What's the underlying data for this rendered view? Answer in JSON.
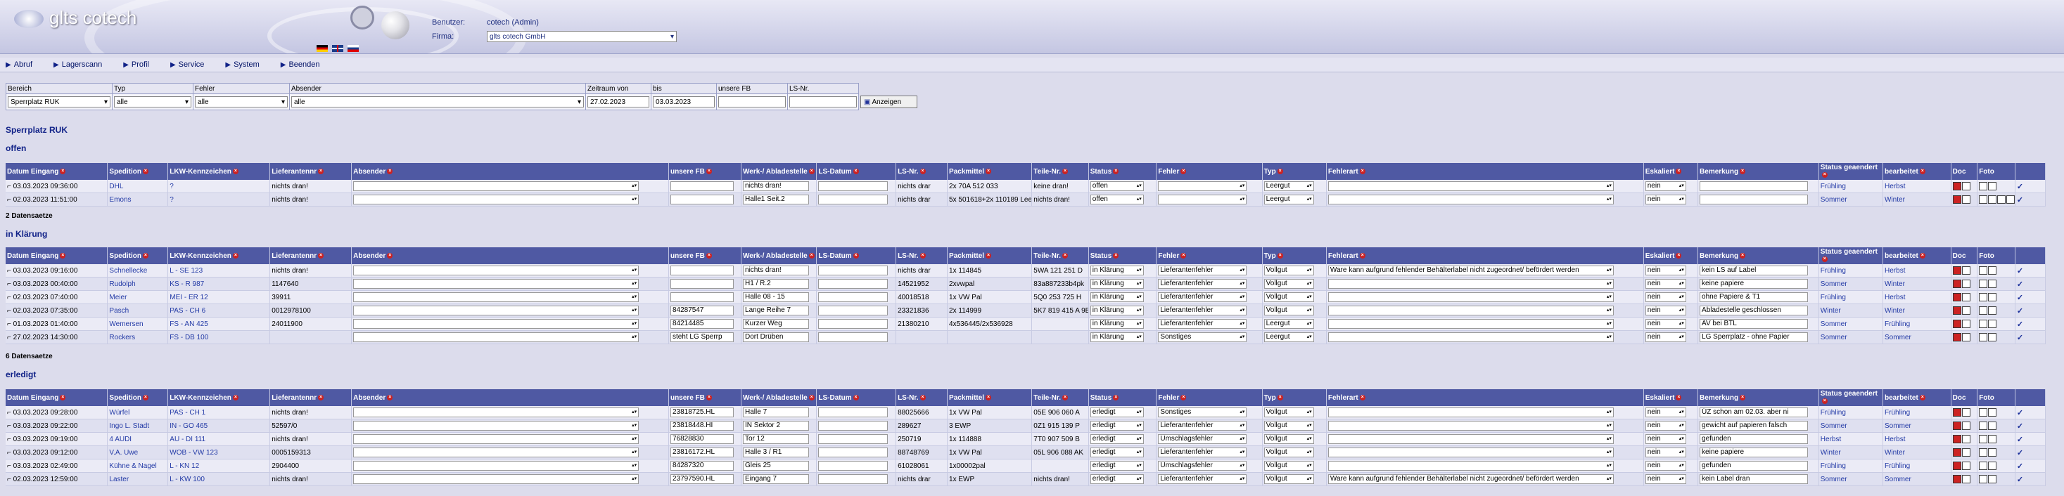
{
  "app": {
    "logo": "glts cotech"
  },
  "user": {
    "benutzer_label": "Benutzer:",
    "benutzer": "cotech (Admin)",
    "firma_label": "Firma:",
    "firma": "glts cotech GmbH"
  },
  "nav": [
    "Abruf",
    "Lagerscann",
    "Profil",
    "Service",
    "System",
    "Beenden"
  ],
  "filter": {
    "labels": [
      "Bereich",
      "Typ",
      "Fehler",
      "Absender",
      "Zeitraum von",
      "bis",
      "unsere FB",
      "LS-Nr."
    ],
    "bereich": "Sperrplatz RUK",
    "typ": "alle",
    "fehler": "alle",
    "absender": "alle",
    "von": "27.02.2023",
    "bis": "03.03.2023",
    "unsere_fb": "",
    "ls_nr": "",
    "button": "Anzeigen"
  },
  "page_title": "Sperrplatz RUK",
  "sections": [
    {
      "title": "offen",
      "count": "2 Datensaetze",
      "headers": [
        "Datum Eingang",
        "Spedition",
        "LKW-Kennzeichen",
        "Lieferantennr",
        "Absender",
        "unsere FB",
        "Werk-/ Abladestelle",
        "LS-Datum",
        "LS-Nr.",
        "Packmittel",
        "Teile-Nr.",
        "Status",
        "Fehler",
        "Typ",
        "Fehlerart",
        "Eskaliert",
        "Bemerkung",
        "Status geaendert",
        "bearbeitet",
        "Doc",
        "Foto",
        ""
      ],
      "rows": [
        [
          "03.03.2023 09:36:00",
          "DHL",
          "?",
          "nichts dran!",
          "",
          "",
          "nichts dran!",
          "",
          "nichts drar",
          "2x 70A 512 033",
          "keine dran!",
          "offen",
          "",
          "Leergut",
          "",
          "nein",
          "",
          "Frühling",
          "Herbst"
        ],
        [
          "02.03.2023 11:51:00",
          "Emons",
          "?",
          "nichts dran!",
          "",
          "",
          "Halle1 Seit.2",
          "",
          "nichts drar",
          "5x 501618+2x 110189 Leergut",
          "nichts dran!",
          "offen",
          "",
          "Leergut",
          "",
          "nein",
          "",
          "Sommer",
          "Winter"
        ]
      ]
    },
    {
      "title": "in Klärung",
      "count": "6 Datensaetze",
      "headers": [
        "Datum Eingang",
        "Spedition",
        "LKW-Kennzeichen",
        "Lieferantennr",
        "Absender",
        "unsere FB",
        "Werk-/ Abladestelle",
        "LS-Datum",
        "LS-Nr.",
        "Packmittel",
        "Teile-Nr.",
        "Status",
        "Fehler",
        "Typ",
        "Fehlerart",
        "Eskaliert",
        "Bemerkung",
        "Status geaendert",
        "bearbeitet",
        "Doc",
        "Foto",
        ""
      ],
      "rows": [
        [
          "03.03.2023 09:16:00",
          "Schnellecke",
          "L - SE 123",
          "nichts dran!",
          "",
          "",
          "nichts dran!",
          "",
          "nichts drar",
          "1x 114845",
          "5WA 121 251 D",
          "in Klärung",
          "Lieferantenfehler",
          "Vollgut",
          "Ware kann aufgrund fehlender Behälterlabel nicht zugeordnet/ befördert werden",
          "nein",
          "kein LS auf Label",
          "Frühling",
          "Herbst"
        ],
        [
          "03.03.2023 00:40:00",
          "Rudolph",
          "KS - R 987",
          "1147640",
          "",
          "",
          "H1 / R.2",
          "",
          "14521952",
          "2xvwpal",
          "83a887233b4pk",
          "in Klärung",
          "Lieferantenfehler",
          "Vollgut",
          "",
          "nein",
          "keine papiere",
          "Sommer",
          "Winter"
        ],
        [
          "02.03.2023 07:40:00",
          "Meier",
          "MEI - ER 12",
          "39911",
          "",
          "",
          "Halle 08 - 15",
          "",
          "40018518",
          "1x VW Pal",
          "5Q0 253 725 H",
          "in Klärung",
          "Lieferantenfehler",
          "Vollgut",
          "",
          "nein",
          "ohne Papiere & T1",
          "Frühling",
          "Herbst"
        ],
        [
          "02.03.2023 07:35:00",
          "Pasch",
          "PAS - CH 6",
          "0012978100",
          "",
          "84287547",
          "Lange Reihe 7",
          "",
          "23321836",
          "2x 114999",
          "5K7 819 415 A 9B9",
          "in Klärung",
          "Lieferantenfehler",
          "Vollgut",
          "",
          "nein",
          "Abladestelle geschlossen",
          "Winter",
          "Winter"
        ],
        [
          "01.03.2023 01:40:00",
          "Wemersen",
          "FS - AN 425",
          "24011900",
          "",
          "84214485",
          "Kurzer Weg",
          "",
          "21380210",
          "4x536445/2x536928",
          "",
          "in Klärung",
          "Lieferantenfehler",
          "Leergut",
          "",
          "nein",
          "AV bei BTL",
          "Sommer",
          "Frühling"
        ],
        [
          "27.02.2023 14:30:00",
          "Rockers",
          "FS - DB 100",
          "",
          "",
          "steht LG Sperrp",
          "Dort Drüben",
          "",
          "",
          "",
          "",
          "in Klärung",
          "Sonstiges",
          "Leergut",
          "",
          "nein",
          "LG Sperrplatz - ohne Papier",
          "Sommer",
          "Sommer"
        ]
      ]
    },
    {
      "title": "erledigt",
      "count": "",
      "headers": [
        "Datum Eingang",
        "Spedition",
        "LKW-Kennzeichen",
        "Lieferantennr",
        "Absender",
        "unsere FB",
        "Werk-/ Abladestelle",
        "LS-Datum",
        "LS-Nr.",
        "Packmittel",
        "Teile-Nr.",
        "Status",
        "Fehler",
        "Typ",
        "Fehlerart",
        "Eskaliert",
        "Bemerkung",
        "Status geaendert",
        "bearbeitet",
        "Doc",
        "Foto",
        ""
      ],
      "rows": [
        [
          "03.03.2023 09:28:00",
          "Würfel",
          "PAS - CH 1",
          "nichts dran!",
          "",
          "23818725.HL",
          "Halle 7",
          "",
          "88025666",
          "1x VW Pal",
          "05E 906 060 A",
          "erledigt",
          "Sonstiges",
          "Vollgut",
          "",
          "nein",
          "ÜZ schon am 02.03. aber ni",
          "Frühling",
          "Frühling"
        ],
        [
          "03.03.2023 09:22:00",
          "Ingo L. Stadt",
          "IN - GO 465",
          "52597/0",
          "",
          "23818448.HI",
          "IN Sektor 2",
          "",
          "289627",
          "3 EWP",
          "0Z1 915 139 P",
          "erledigt",
          "Lieferantenfehler",
          "Vollgut",
          "",
          "nein",
          "gewicht auf papieren falsch",
          "Sommer",
          "Sommer"
        ],
        [
          "03.03.2023 09:19:00",
          "4 AUDI",
          "AU - DI 111",
          "nichts dran!",
          "",
          "76828830",
          "Tor 12",
          "",
          "250719",
          "1x 114888",
          "7T0 907 509 B",
          "erledigt",
          "Umschlagsfehler",
          "Vollgut",
          "",
          "nein",
          "gefunden",
          "Herbst",
          "Herbst"
        ],
        [
          "03.03.2023 09:12:00",
          "V.A. Uwe",
          "WOB - VW 123",
          "0005159313",
          "",
          "23816172.HL",
          "Halle 3 / R1",
          "",
          "88748769",
          "1x VW Pal",
          "05L 906 088 AK",
          "erledigt",
          "Lieferantenfehler",
          "Vollgut",
          "",
          "nein",
          "keine papiere",
          "Winter",
          "Winter"
        ],
        [
          "03.03.2023 02:49:00",
          "Kühne & Nagel",
          "L - KN 12",
          "2904400",
          "",
          "84287320",
          "Gleis 25",
          "",
          "61028061",
          "1x00002pal",
          "",
          "erledigt",
          "Umschlagsfehler",
          "Vollgut",
          "",
          "nein",
          "gefunden",
          "Frühling",
          "Frühling"
        ],
        [
          "02.03.2023 12:59:00",
          "Laster",
          "L - KW 100",
          "nichts dran!",
          "",
          "23797590.HL",
          "Eingang 7",
          "",
          "nichts drar",
          "1x EWP",
          "nichts dran!",
          "erledigt",
          "Lieferantenfehler",
          "Vollgut",
          "Ware kann aufgrund fehlender Behälterlabel nicht zugeordnet/ befördert werden",
          "nein",
          "kein Label dran",
          "Sommer",
          "Sommer"
        ]
      ]
    }
  ]
}
